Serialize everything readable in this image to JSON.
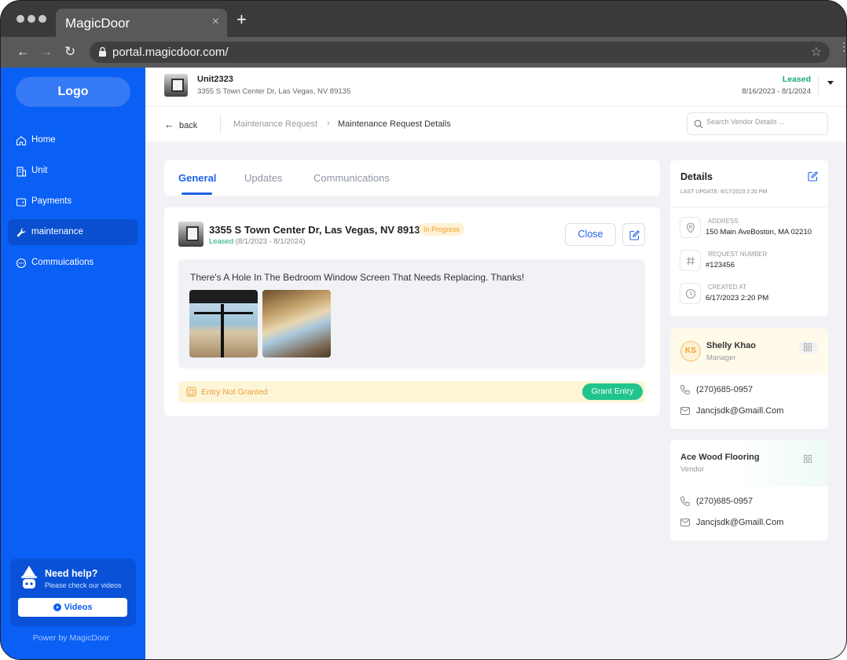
{
  "browser": {
    "tab_title": "MagicDoor",
    "tab_close": "×",
    "new_tab": "+",
    "url": "portal.magicdoor.com/"
  },
  "sidebar": {
    "logo": "Logo",
    "items": [
      {
        "label": "Home",
        "icon": "home-icon"
      },
      {
        "label": "Unit",
        "icon": "building-icon"
      },
      {
        "label": "Payments",
        "icon": "wallet-icon"
      },
      {
        "label": "maintenance",
        "icon": "wrench-icon",
        "active": true
      },
      {
        "label": "Commuications",
        "icon": "chat-icon"
      }
    ],
    "help": {
      "title": "Need help?",
      "subtitle": "Please check our videos",
      "button": "Videos"
    },
    "powered_by": "Power by MagicDoor"
  },
  "unit": {
    "name": "Unit2323",
    "address": "3355 S Town Center Dr, Las Vegas, NV 89135",
    "status": "Leased",
    "dates": "8/16/2023 - 8/1/2024"
  },
  "breadcrumb": {
    "back": "back",
    "parent": "Maintenance Request",
    "current": "Maintenance Request Details"
  },
  "search": {
    "placeholder": "Search Vendor Details ..."
  },
  "tabs": [
    "General",
    "Updates",
    "Communications"
  ],
  "request": {
    "address": "3355 S Town Center Dr, Las Vegas, NV 89135",
    "badge": "In Progress",
    "lease_status": "Leased",
    "lease_dates": " (8/1/2023 - 8/1/2024)",
    "close_label": "Close",
    "description": "There's A Hole In The Bedroom Window Screen That Needs Replacing. Thanks!",
    "entry_status": "Entry Not Granted",
    "grant_label": "Grant Entry"
  },
  "details": {
    "title": "Details",
    "last_update": "LAST UPDATE:  6/17/2023 2:20 PM",
    "rows": [
      {
        "label": "ADDRESS",
        "value": "150 Main AveBoston, MA 02210",
        "icon": "location-icon"
      },
      {
        "label": "REQUEST NUMBER",
        "value": "#123456",
        "icon": "hash-icon"
      },
      {
        "label": "CREATED AT",
        "value": "6/17/2023 2:20 PM",
        "icon": "clock-icon"
      }
    ]
  },
  "manager": {
    "initials": "KS",
    "name": "Shelly Khao",
    "role": "Manager",
    "phone": "(270)685-0957",
    "email": "Jancjsdk@Gmaill.Com"
  },
  "vendor": {
    "name": "Ace Wood Flooring",
    "role": "Vendor",
    "phone": "(270)685-0957",
    "email": "Jancjsdk@Gmaill.Com"
  },
  "colors": {
    "sidebar": "#0a5ff4",
    "accent": "#1e63e9",
    "leased_green": "#1ba97a",
    "badge_orange": "#f1a024",
    "grant_green": "#21c48c"
  }
}
